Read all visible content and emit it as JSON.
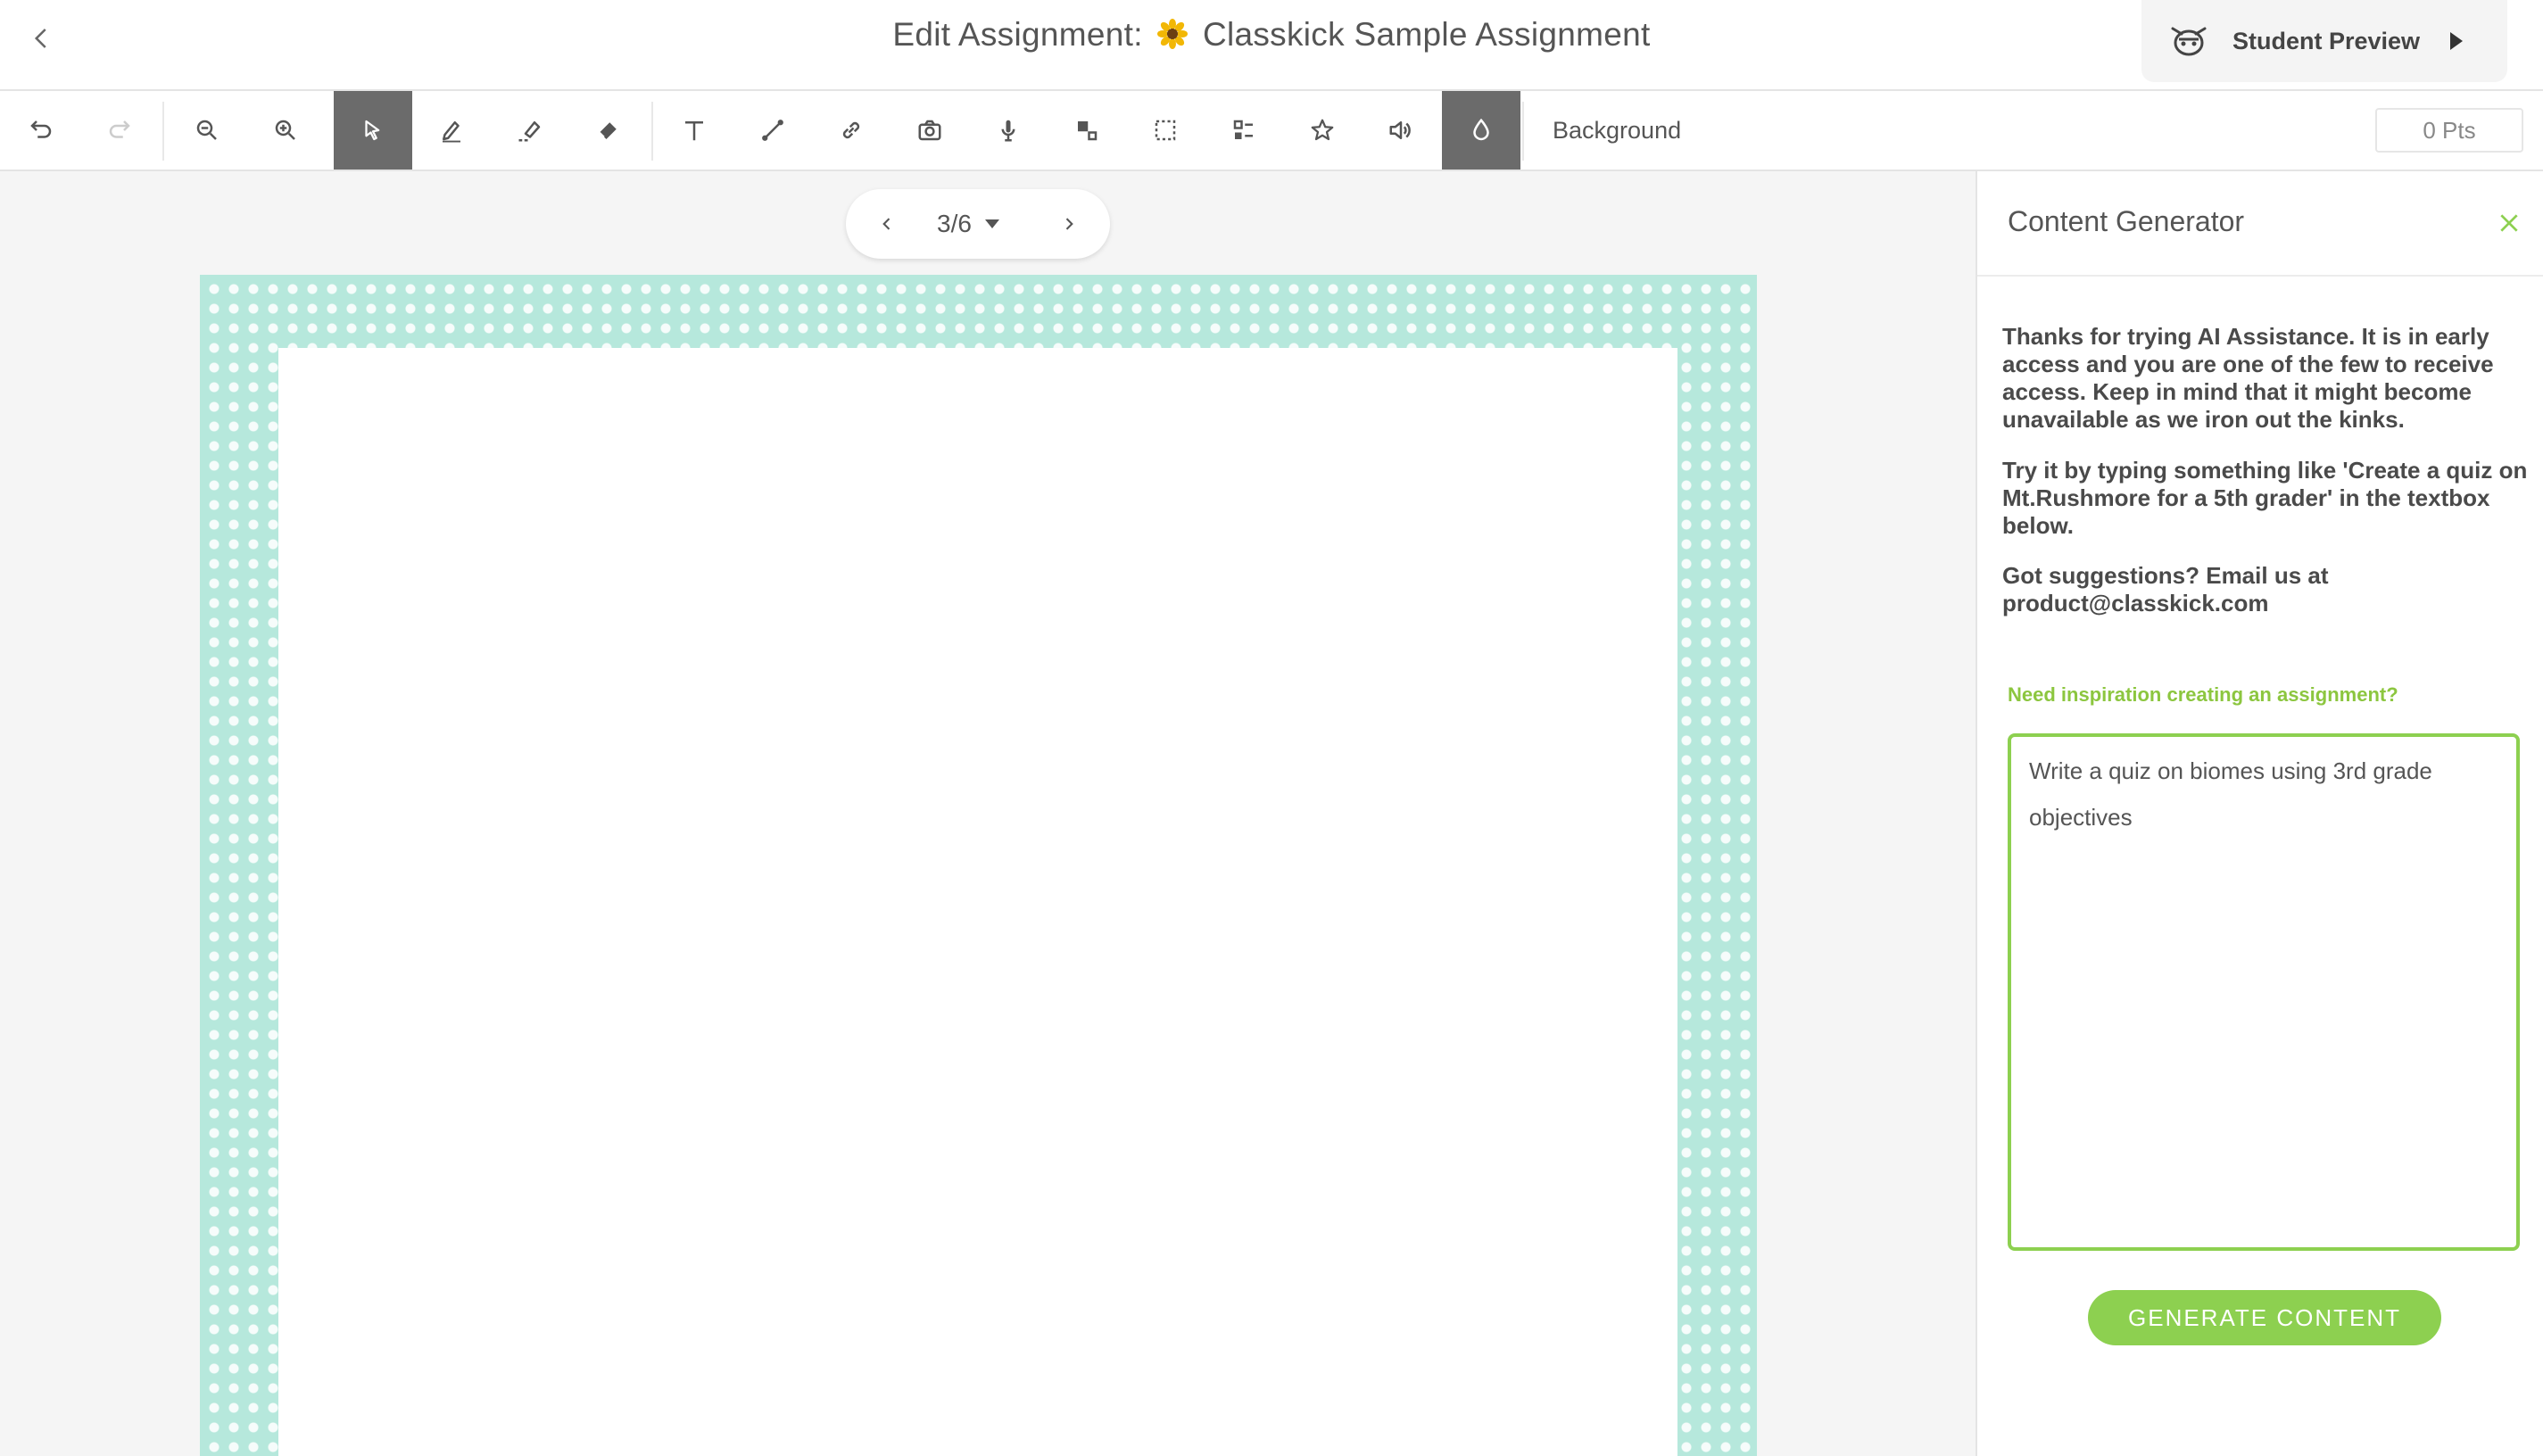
{
  "header": {
    "title_prefix": "Edit Assignment:",
    "title_name": "Classkick Sample Assignment",
    "student_preview_label": "Student Preview"
  },
  "toolbar": {
    "tools": [
      "undo-icon",
      "redo-icon",
      "zoom-out-icon",
      "zoom-in-icon",
      "select-icon",
      "pen-icon",
      "highlighter-icon",
      "eraser-icon",
      "text-icon",
      "line-icon",
      "link-icon",
      "camera-icon",
      "microphone-icon",
      "shapes-icon",
      "selection-box-icon",
      "multiple-choice-icon",
      "star-icon",
      "audio-icon",
      "background-icon"
    ],
    "active_tools": [
      "select-icon",
      "background-icon"
    ],
    "background_label": "Background",
    "points_value": "0 Pts"
  },
  "page_nav": {
    "current": "3/6"
  },
  "panel": {
    "title": "Content Generator",
    "intro": "Thanks for trying AI Assistance. It is in early access and you are one of the few to receive access. Keep in mind that it might become unavailable as we iron out the kinks.",
    "tryit": "Try it by typing something like 'Create a quiz on Mt.Rushmore for a 5th grader' in the textbox below.",
    "suggestions": "Got suggestions? Email us at product@classkick.com",
    "inspiration": "Need inspiration creating an assignment?",
    "prompt_value": "Write a quiz on biomes using 3rd grade objectives",
    "generate_label": "GENERATE CONTENT"
  },
  "colors": {
    "accent_green": "#8dd050",
    "active_tool_bg": "#6b6b6b",
    "canvas_border": "#b6e8dc",
    "panel_bg": "#ffffff"
  }
}
